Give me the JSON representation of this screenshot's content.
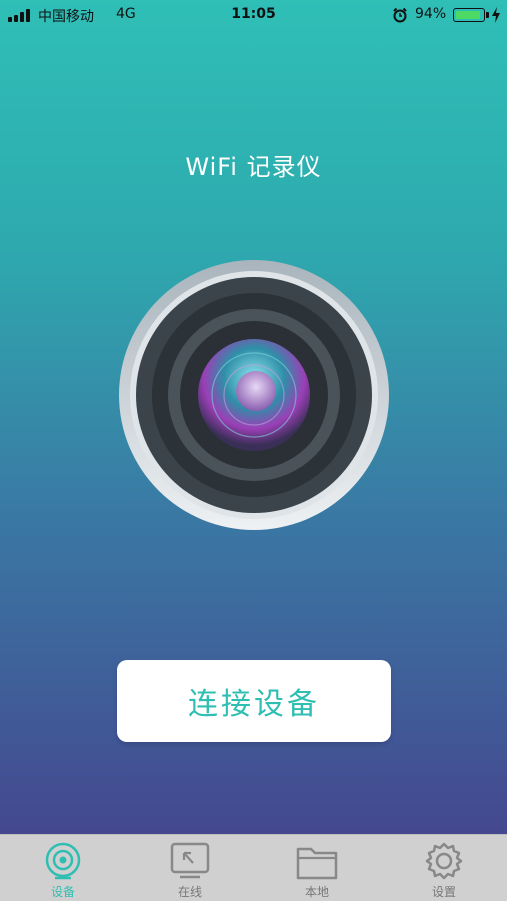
{
  "status_bar": {
    "carrier": "中国移动",
    "network": "4G",
    "time": "11:05",
    "battery_percent": "94%",
    "battery_level": 0.94
  },
  "title": "WiFi 记录仪",
  "connect_button": "连接设备",
  "tabs": [
    {
      "label": "设备",
      "icon": "camera-icon",
      "active": true
    },
    {
      "label": "在线",
      "icon": "online-frame-icon",
      "active": false
    },
    {
      "label": "本地",
      "icon": "folder-icon",
      "active": false
    },
    {
      "label": "设置",
      "icon": "gear-icon",
      "active": false
    }
  ],
  "colors": {
    "accent": "#2fbfb2",
    "gradient_top": "#2fbfb7",
    "gradient_bottom": "#44488f",
    "tabbar": "#d0d0d0"
  }
}
